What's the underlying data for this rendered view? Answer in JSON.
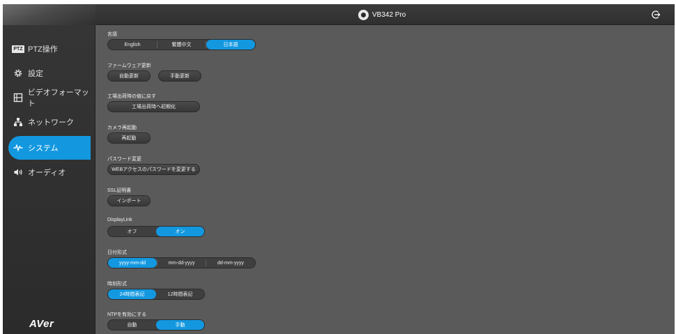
{
  "header": {
    "camera_name": "VB342 Pro"
  },
  "sidebar": {
    "items": [
      {
        "label": "PTZ操作",
        "icon": "ptz-badge-icon",
        "badge": "PTZ"
      },
      {
        "label": "設定",
        "icon": "gear-icon"
      },
      {
        "label": "ビデオフォーマット",
        "icon": "film-icon"
      },
      {
        "label": "ネットワーク",
        "icon": "network-icon"
      },
      {
        "label": "システム",
        "icon": "pulse-icon",
        "active": true
      },
      {
        "label": "オーディオ",
        "icon": "speaker-icon"
      }
    ],
    "logo": "AVer"
  },
  "settings": {
    "language": {
      "label": "言語",
      "options": [
        "English",
        "繁體中文",
        "日本語"
      ],
      "selected": "日本語"
    },
    "firmware": {
      "label": "ファームウェア更新",
      "buttons": [
        "自動更新",
        "手動更新"
      ]
    },
    "factory_reset": {
      "label": "工場出荷時の値に戻す",
      "button": "工場出荷時へ初期化"
    },
    "camera_restart": {
      "label": "カメラ再起動",
      "button": "再起動"
    },
    "password": {
      "label": "パスワード変更",
      "button": "WEBアクセスのパスワードを変更する"
    },
    "ssl": {
      "label": "SSL証明書",
      "button": "インポート"
    },
    "displaylink": {
      "label": "DisplayLink",
      "options": [
        "オフ",
        "オン"
      ],
      "selected": "オン"
    },
    "date_format": {
      "label": "日付形式",
      "options": [
        "yyyy-mm-dd",
        "mm-dd-yyyy",
        "dd-mm-yyyy"
      ],
      "selected": "yyyy-mm-dd"
    },
    "time_format": {
      "label": "時刻形式",
      "options": [
        "24時間表記",
        "12時間表記"
      ],
      "selected": "24時間表記"
    },
    "ntp": {
      "label": "NTPを有効にする",
      "options": [
        "自動",
        "手動"
      ],
      "selected": "手動"
    }
  },
  "colors": {
    "accent": "#1398e0",
    "sidebar_bg": "#2f2f2f",
    "content_bg": "#5a5a5a"
  }
}
